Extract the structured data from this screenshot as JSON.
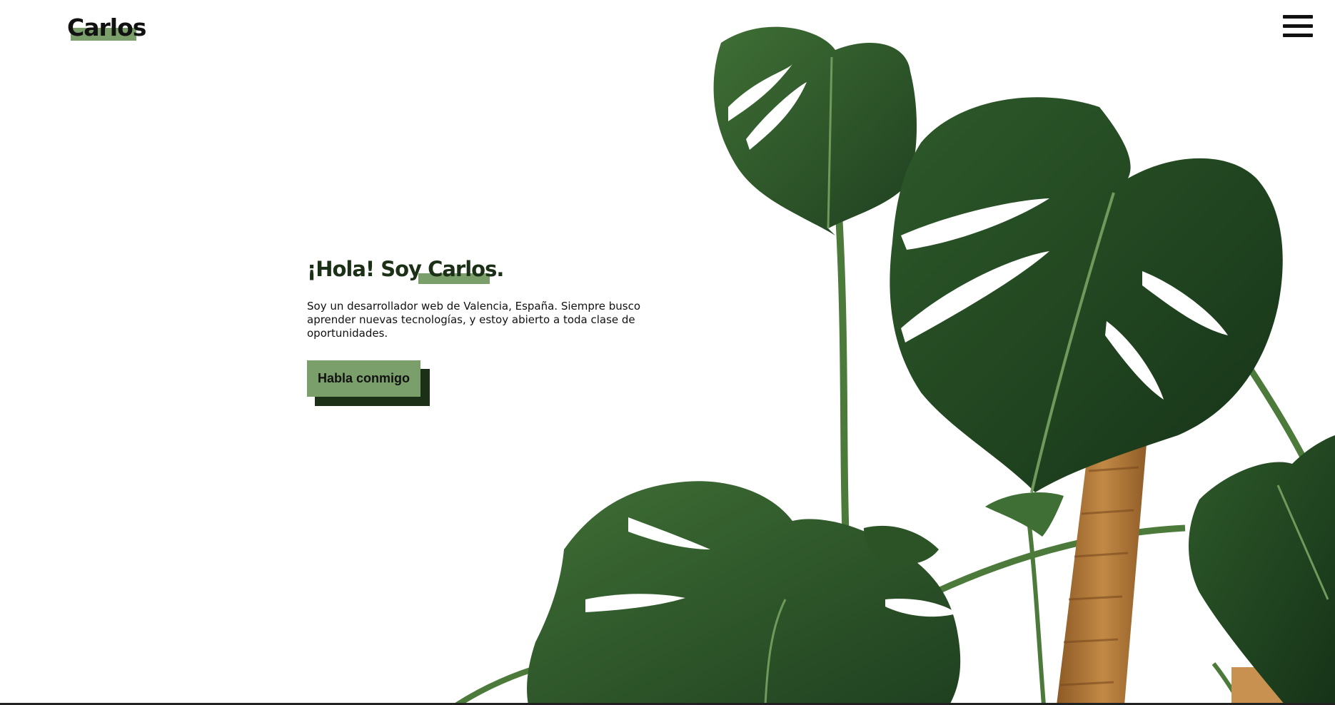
{
  "header": {
    "logo": "Carlos",
    "menu_icon": "hamburger-menu-icon"
  },
  "hero": {
    "title_prefix": "¡Hola! Soy ",
    "title_highlight": "Carlos.",
    "description": "Soy un desarrollador web de Valencia, España. Siempre busco aprender nuevas tecnologías, y estoy abierto a toda clase de oportunidades.",
    "cta_label": "Habla conmigo"
  },
  "decor": {
    "image": "monstera-plant-image"
  },
  "colors": {
    "accent": "#7a9f6b",
    "dark_green": "#1b3016",
    "leaf": "#2f5a2a",
    "leaf_dark": "#1f4020",
    "stake": "#b07a3c"
  }
}
